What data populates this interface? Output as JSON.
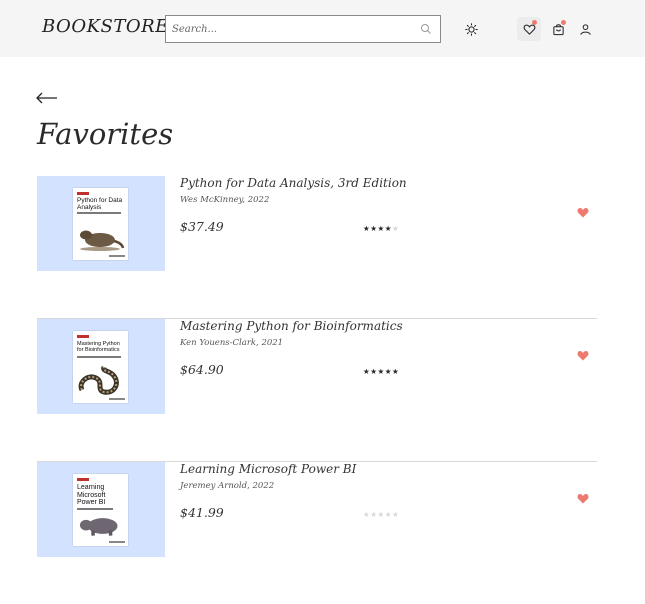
{
  "header": {
    "logo": "BOOKSTORE",
    "search_placeholder": "Search...",
    "icons": [
      "sun-icon",
      "heart-icon",
      "shopping-bag-icon",
      "user-icon"
    ],
    "accent_color": "#ee7a6f"
  },
  "page": {
    "title": "Favorites",
    "back_icon": "arrow-left-icon"
  },
  "favorites": [
    {
      "title": "Python for Data Analysis, 3rd Edition",
      "author": "Wes McKinney, 2022",
      "price": "$37.49",
      "rating": 4,
      "max_rating": 5,
      "cover_title": "Python for Data Analysis",
      "cover_color": "#d3e2ff"
    },
    {
      "title": "Mastering Python for Bioinformatics",
      "author": "Ken Youens-Clark, 2021",
      "price": "$64.90",
      "rating": 5,
      "max_rating": 5,
      "cover_title": "Mastering Python for Bioinformatics",
      "cover_color": "#d3e2ff"
    },
    {
      "title": "Learning Microsoft Power BI",
      "author": "Jeremey Arnold, 2022",
      "price": "$41.99",
      "rating": 0,
      "max_rating": 5,
      "cover_title": "Learning Microsoft Power BI",
      "cover_color": "#d3e2ff"
    }
  ]
}
